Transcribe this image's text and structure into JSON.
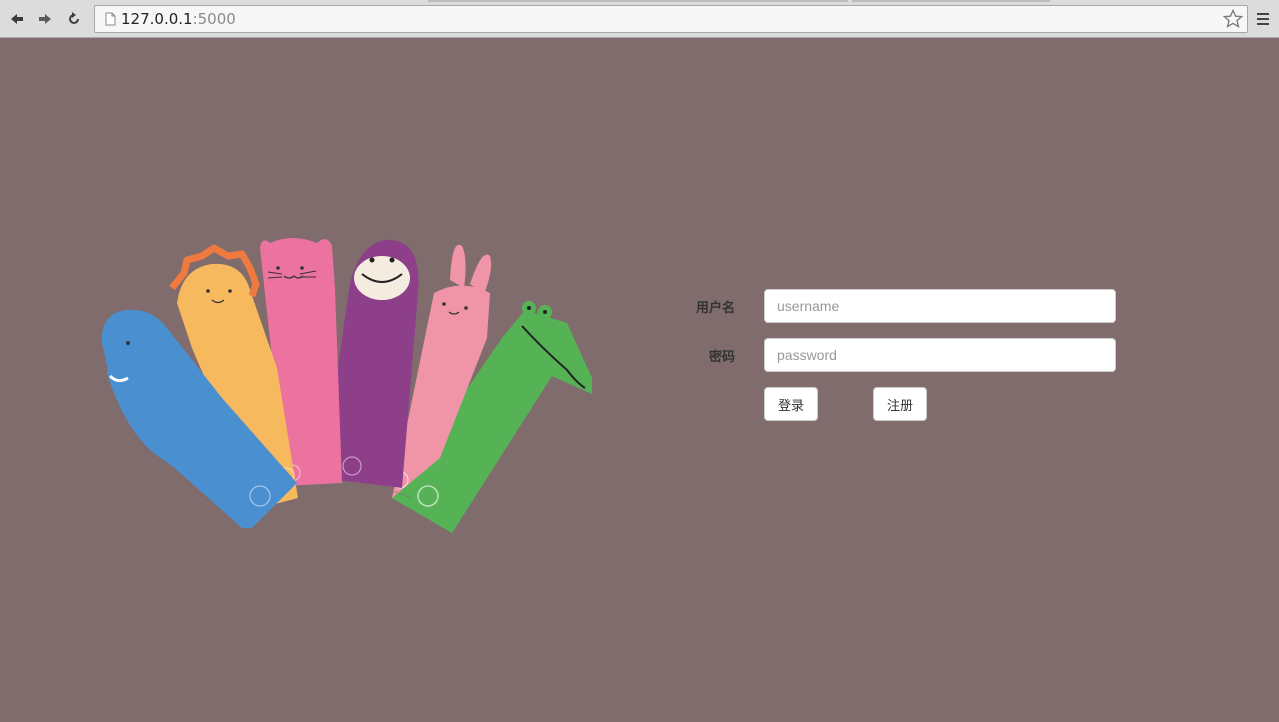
{
  "browser": {
    "url_host": "127.0.0.1",
    "url_port": ":5000",
    "back_icon": "back-arrow-icon",
    "forward_icon": "forward-arrow-icon",
    "reload_icon": "reload-icon",
    "bookmark_icon": "star-icon",
    "menu_icon": "hamburger-menu-icon"
  },
  "page": {
    "background_color": "#806c6c",
    "illustration": {
      "animals": [
        "elephant",
        "lion",
        "cat",
        "monkey",
        "rabbit",
        "crocodile"
      ],
      "colors": [
        "#4a90d0",
        "#f7b95e",
        "#ec729f",
        "#8e3f8a",
        "#f095a8",
        "#55b356"
      ]
    }
  },
  "login_form": {
    "username_label": "用户名",
    "username_placeholder": "username",
    "username_value": "",
    "password_label": "密码",
    "password_placeholder": "password",
    "password_value": "",
    "login_button": "登录",
    "register_button": "注册"
  }
}
